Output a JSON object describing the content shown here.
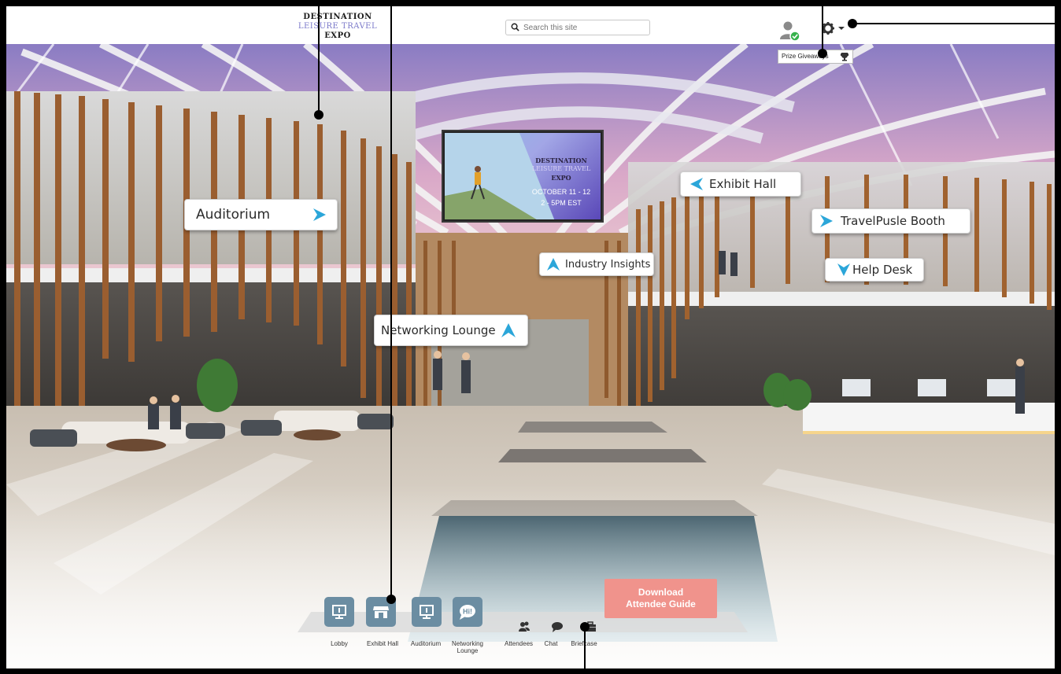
{
  "header": {
    "logo": {
      "line1": "DESTINATION",
      "line2": "LEISURE TRAVEL",
      "line3": "EXPO"
    },
    "search_placeholder": "Search this site",
    "tooltip": "Prize Giveaways"
  },
  "icons": {
    "search": "search-icon",
    "user": "user-online-icon",
    "settings": "gear-icon",
    "prize": "trophy-icon"
  },
  "screen": {
    "line1": "DESTINATION",
    "line2": "LEISURE TRAVEL",
    "line3": "EXPO",
    "date": "OCTOBER 11 - 12",
    "time": "2 - 5PM EST"
  },
  "signs": {
    "auditorium": "Auditorium",
    "exhibit_hall": "Exhibit Hall",
    "travelpulse_booth": "TravelPusle Booth",
    "industry_insights": "Industry Insights",
    "help_desk": "Help Desk",
    "networking_lounge": "Networking Lounge"
  },
  "bottom_nav": {
    "lobby": "Lobby",
    "exhibit_hall": "Exhibit Hall",
    "auditorium": "Auditorium",
    "networking_line1": "Networking",
    "networking_line2": "Lounge",
    "networking_icon_text": "Hi!",
    "attendees": "Attendees",
    "chat": "Chat",
    "briefcase": "Briefcase"
  },
  "download_button": {
    "line1": "Download",
    "line2": "Attendee Guide"
  },
  "colors": {
    "sign_arrow": "#2ba6d9",
    "nav_button": "#6b8da2",
    "download": "#f0938c",
    "logo_purple": "#7a78c9"
  }
}
